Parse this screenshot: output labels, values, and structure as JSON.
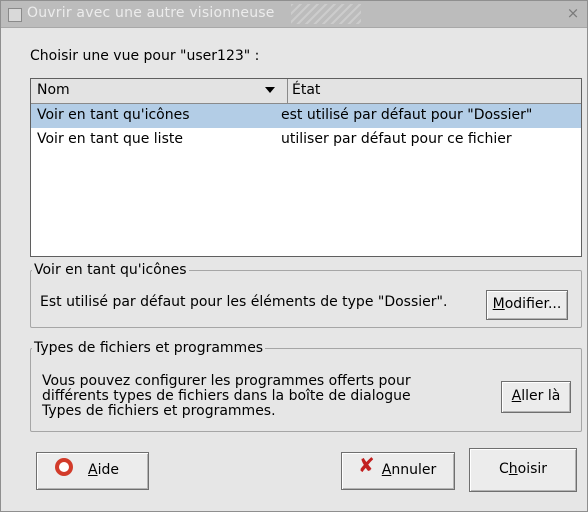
{
  "window": {
    "title": "Ouvrir avec une autre visionneuse",
    "close_glyph": "×"
  },
  "prompt": "Choisir une vue pour \"user123\" :",
  "list": {
    "columns": {
      "name": "Nom",
      "state": "État"
    },
    "rows": [
      {
        "name": "Voir en tant qu'icônes",
        "state": "est utilisé par défaut pour \"Dossier\""
      },
      {
        "name": "Voir en tant que liste",
        "state": "utiliser par défaut pour ce fichier"
      }
    ],
    "selected_index": 0
  },
  "view_frame": {
    "legend": "Voir en tant qu'icônes",
    "text": "Est utilisé par défaut pour les éléments de type \"Dossier\".",
    "button": {
      "mnemonic": "M",
      "rest": "odifier..."
    }
  },
  "types_frame": {
    "legend": "Types de fichiers et programmes",
    "text_lines": [
      "Vous pouvez configurer les programmes offerts pour",
      "différents types de fichiers dans la boîte de dialogue",
      "Types de fichiers et programmes."
    ],
    "button": {
      "mnemonic": "A",
      "rest": "ller là"
    }
  },
  "buttons": {
    "help": {
      "mnemonic": "A",
      "rest": "ide",
      "icon": "lifebuoy-icon"
    },
    "cancel": {
      "mnemonic": "A",
      "rest": "nnuler",
      "icon": "cancel-x-icon"
    },
    "choose": {
      "prefix": "C",
      "mnemonic": "h",
      "rest": "oisir"
    }
  },
  "colors": {
    "selection": "#b3cde6",
    "titlebar": "#bcbcbc",
    "dialog_bg": "#e6e6e6"
  }
}
